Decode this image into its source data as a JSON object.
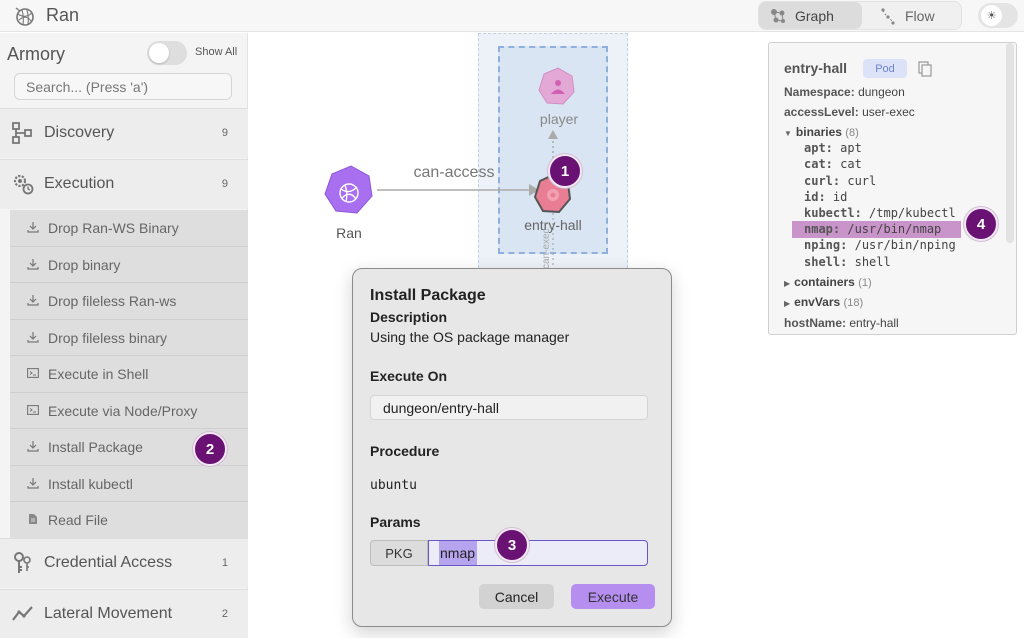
{
  "app": {
    "title": "Ran"
  },
  "view_tabs": [
    {
      "label": "Graph",
      "active": true
    },
    {
      "label": "Flow",
      "active": false
    }
  ],
  "sidebar": {
    "title": "Armory",
    "show_all_label": "Show All",
    "search_placeholder": "Search... (Press 'a')",
    "categories": [
      {
        "label": "Discovery",
        "count": "9",
        "icon": "hierarchy-icon"
      },
      {
        "label": "Execution",
        "count": "9",
        "icon": "gears-icon"
      },
      {
        "label": "Credential Access",
        "count": "1",
        "icon": "keys-icon"
      },
      {
        "label": "Lateral Movement",
        "count": "2",
        "icon": "trend-line-icon"
      }
    ],
    "execution_items": [
      {
        "label": "Drop Ran-WS Binary",
        "icon": "download-icon"
      },
      {
        "label": "Drop binary",
        "icon": "download-icon"
      },
      {
        "label": "Drop fileless Ran-ws",
        "icon": "download-icon"
      },
      {
        "label": "Drop fileless binary",
        "icon": "download-icon"
      },
      {
        "label": "Execute in Shell",
        "icon": "terminal-icon"
      },
      {
        "label": "Execute via Node/Proxy",
        "icon": "terminal-icon"
      },
      {
        "label": "Install Package",
        "icon": "download-icon"
      },
      {
        "label": "Install kubectl",
        "icon": "download-icon"
      },
      {
        "label": "Read File",
        "icon": "file-icon"
      }
    ]
  },
  "graph": {
    "nodes": {
      "ran": "Ran",
      "player": "player",
      "entry_hall": "entry-hall"
    },
    "edges": {
      "can_access": "can-access",
      "vertical_label": "can-exec"
    }
  },
  "modal": {
    "title": "Install Package",
    "subtitle": "Description",
    "description": "Using the OS package manager",
    "execute_on_label": "Execute On",
    "execute_on_value": "dungeon/entry-hall",
    "procedure_label": "Procedure",
    "procedure_value": "ubuntu",
    "params_label": "Params",
    "param_key": "PKG",
    "param_value": "nmap",
    "cancel_label": "Cancel",
    "execute_label": "Execute"
  },
  "details": {
    "name": "entry-hall",
    "kind": "Pod",
    "namespace_label": "Namespace:",
    "namespace": "dungeon",
    "access_label": "accessLevel:",
    "access": "user-exec",
    "binaries_label": "binaries",
    "binaries_count": "(8)",
    "binaries": [
      {
        "k": "apt:",
        "v": "apt"
      },
      {
        "k": "cat:",
        "v": "cat"
      },
      {
        "k": "curl:",
        "v": "curl"
      },
      {
        "k": "id:",
        "v": "id"
      },
      {
        "k": "kubectl:",
        "v": "/tmp/kubectl"
      },
      {
        "k": "nmap:",
        "v": "/usr/bin/nmap"
      },
      {
        "k": "nping:",
        "v": "/usr/bin/nping"
      },
      {
        "k": "shell:",
        "v": "shell"
      }
    ],
    "containers_label": "containers",
    "containers_count": "(1)",
    "envvars_label": "envVars",
    "envvars_count": "(18)",
    "hostname_label": "hostName:",
    "hostname": "entry-hall"
  },
  "badges": [
    "1",
    "2",
    "3",
    "4"
  ],
  "colors": {
    "accent": "#b68ef0",
    "badge": "#6a1274",
    "node": "#a86ff0",
    "highlight": "#c994c9"
  }
}
